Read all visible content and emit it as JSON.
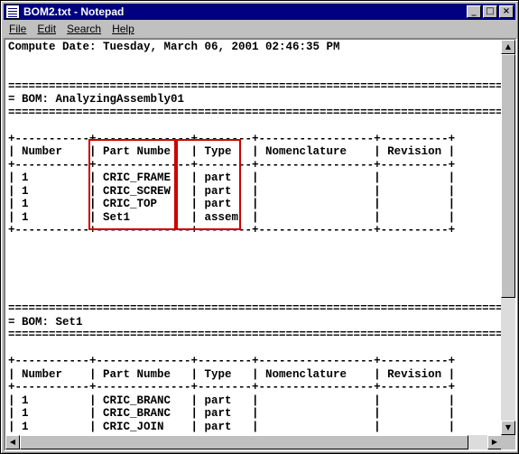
{
  "window": {
    "title": "BOM2.txt - Notepad"
  },
  "menubar": {
    "items": [
      {
        "label": "File"
      },
      {
        "label": "Edit"
      },
      {
        "label": "Search"
      },
      {
        "label": "Help"
      }
    ]
  },
  "document": {
    "lines": [
      "Compute Date: Tuesday, March 06, 2001 02:46:35 PM",
      "",
      "",
      "================================================================================",
      "= BOM: AnalyzingAssembly01                                                     =",
      "================================================================================",
      "",
      "+-----------+--------------+--------+-----------------+----------+",
      "| Number    | Part Numbe   | Type   | Nomenclature    | Revision |",
      "+-----------+--------------+--------+-----------------+----------+",
      "| 1         | CRIC_FRAME   | part   |                 |          |",
      "| 1         | CRIC_SCREW   | part   |                 |          |",
      "| 1         | CRIC_TOP     | part   |                 |          |",
      "| 1         | Set1         | assem  |                 |          |",
      "+-----------+--------------+--------+-----------------+----------+",
      "",
      "",
      "",
      "",
      "",
      "================================================================================",
      "= BOM: Set1                                                                    =",
      "================================================================================",
      "",
      "+-----------+--------------+--------+-----------------+----------+",
      "| Number    | Part Numbe   | Type   | Nomenclature    | Revision |",
      "+-----------+--------------+--------+-----------------+----------+",
      "| 1         | CRIC_BRANC   | part   |                 |          |",
      "| 1         | CRIC_BRANC   | part   |                 |          |",
      "| 1         | CRIC_JOIN    | part   |                 |          |",
      "+-----------+--------------+--------+-----------------+----------+"
    ]
  },
  "title_buttons": {
    "minimize": "_",
    "maximize": "□",
    "close": "×"
  },
  "scrollbar": {
    "up": "▲",
    "down": "▼",
    "left": "◀",
    "right": "▶"
  },
  "colors": {
    "titlebar": "#000080",
    "highlight": "#cc0000"
  }
}
